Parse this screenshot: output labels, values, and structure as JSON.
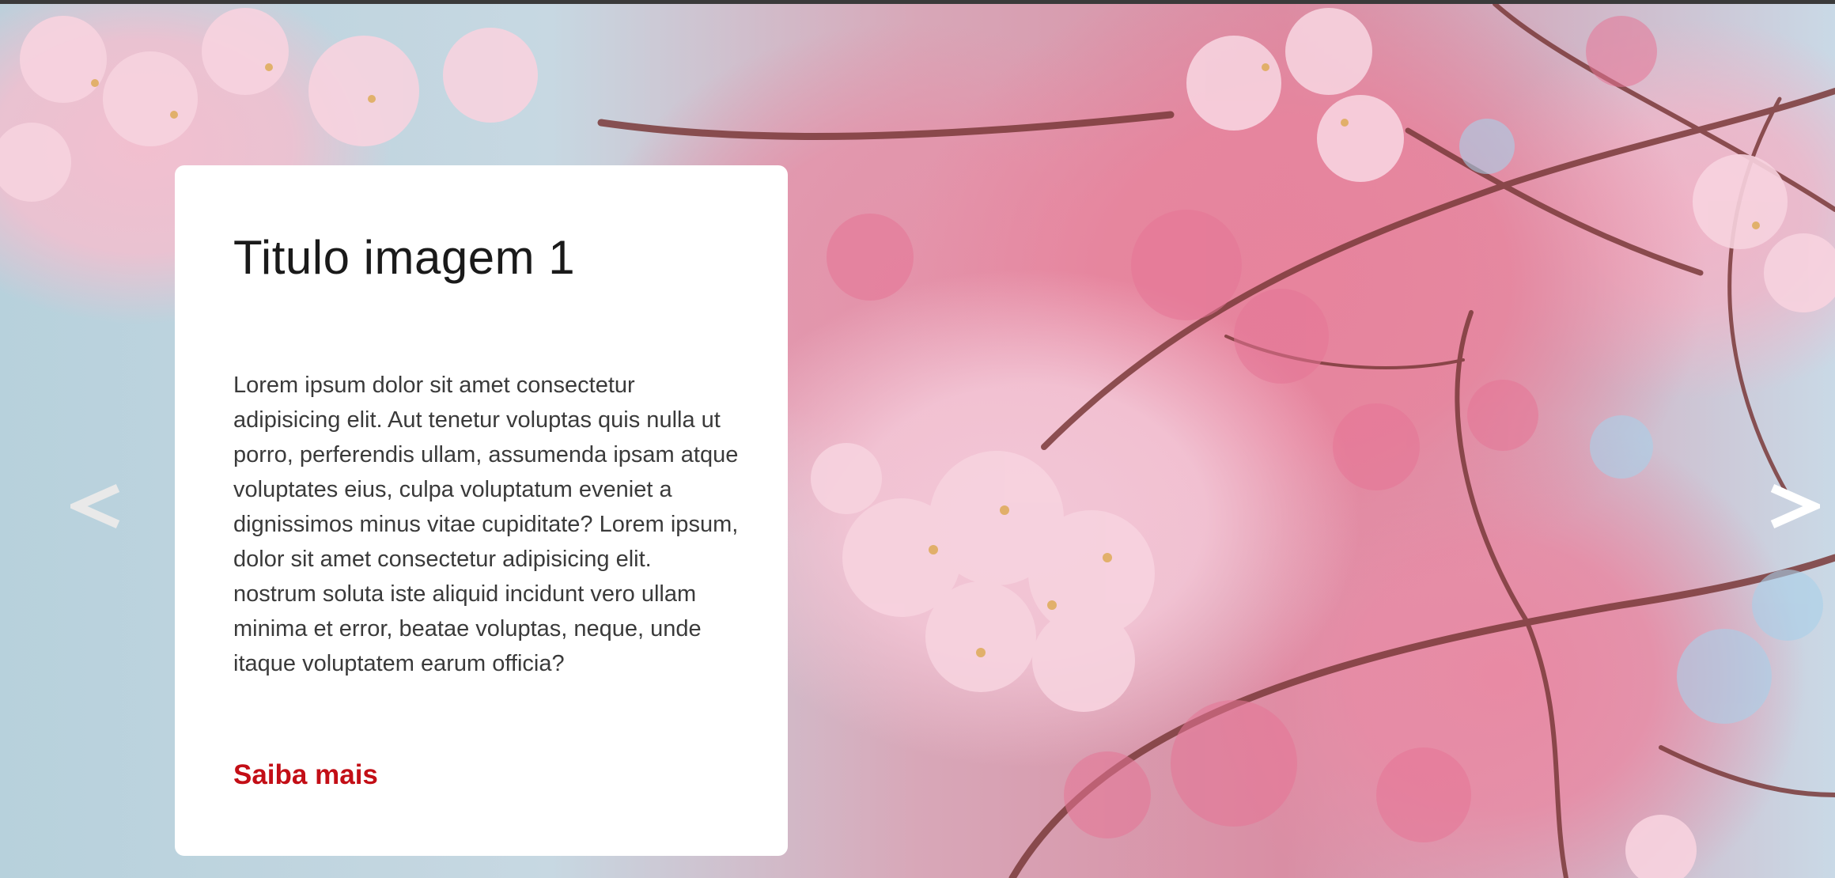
{
  "slider": {
    "prev_icon": "chevron-left-icon",
    "next_icon": "chevron-right-icon",
    "arrow_colors": {
      "prev": "#e9e9e9",
      "next": "#ffffff"
    }
  },
  "card": {
    "title": "Titulo imagem 1",
    "text": "Lorem ipsum dolor sit amet consectetur adipisicing elit. Aut tenetur voluptas quis nulla ut porro, perferendis ullam, assumenda ipsam atque voluptates eius, culpa voluptatum eveniet a dignissimos minus vitae cupiditate? Lorem ipsum, dolor sit amet consectetur adipisicing elit. nostrum soluta iste aliquid incidunt vero ullam minima et error, beatae voluptas, neque, unde itaque voluptatem earum officia?",
    "link_label": "Saiba mais",
    "link_color": "#c30e16"
  }
}
